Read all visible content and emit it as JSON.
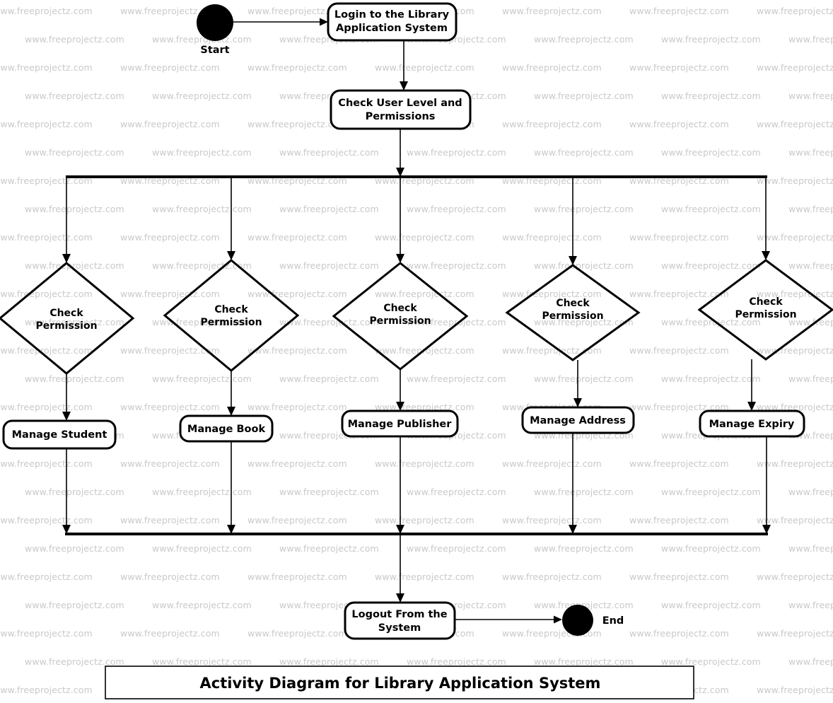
{
  "diagram": {
    "caption": "Activity Diagram for Library Application System",
    "start_label": "Start",
    "end_label": "End",
    "initial_action": "Login to the Library Application System",
    "check_action": "Check User Level and Permissions",
    "final_action": "Logout From the System",
    "branches": [
      {
        "decision": "Check Permission",
        "action": "Manage Student"
      },
      {
        "decision": "Check Permission",
        "action": "Manage Book"
      },
      {
        "decision": "Check Permission",
        "action": "Manage Publisher"
      },
      {
        "decision": "Check Permission",
        "action": "Manage Address"
      },
      {
        "decision": "Check Permission",
        "action": "Manage Expiry"
      }
    ],
    "colors": {
      "stroke": "#000000",
      "fill": "#ffffff",
      "watermark": "#c9c9c9"
    }
  },
  "watermark": {
    "text": "www.freeprojectz.com"
  }
}
